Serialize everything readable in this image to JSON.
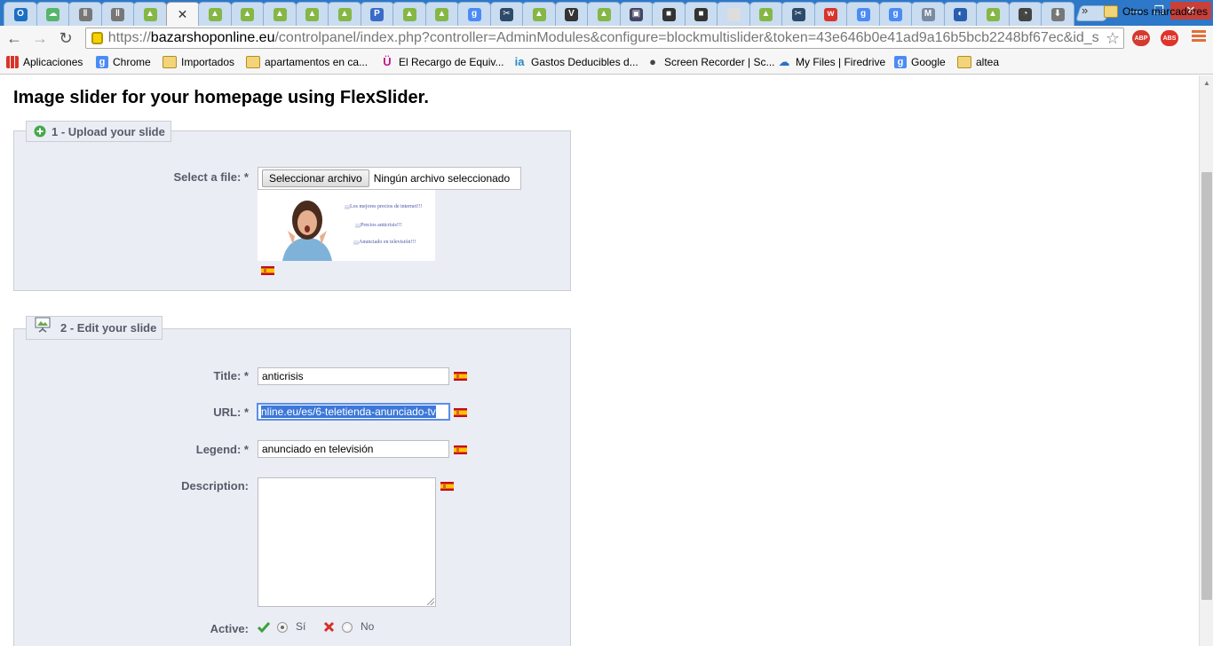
{
  "browser": {
    "tabs": [
      {
        "icon": "outlook-icon",
        "color": "#1b6fc4",
        "glyph": "O"
      },
      {
        "icon": "cloud-icon",
        "color": "#56b56c",
        "glyph": "☁"
      },
      {
        "icon": "pause-icon",
        "color": "#777777",
        "glyph": "‖"
      },
      {
        "icon": "pause-icon",
        "color": "#777777",
        "glyph": "‖"
      },
      {
        "icon": "shop-icon",
        "color": "#84b745",
        "glyph": "▲"
      },
      {
        "icon": "close-icon",
        "color": "#333333",
        "glyph": "✕"
      },
      {
        "icon": "shop-icon",
        "color": "#84b745",
        "glyph": "▲"
      },
      {
        "icon": "shop-icon",
        "color": "#84b745",
        "glyph": "▲"
      },
      {
        "icon": "shop-icon",
        "color": "#84b745",
        "glyph": "▲"
      },
      {
        "icon": "shop-icon",
        "color": "#84b745",
        "glyph": "▲"
      },
      {
        "icon": "shop-icon",
        "color": "#84b745",
        "glyph": "▲"
      },
      {
        "icon": "p-icon",
        "color": "#3b6bc9",
        "glyph": "P"
      },
      {
        "icon": "shop-icon",
        "color": "#84b745",
        "glyph": "▲"
      },
      {
        "icon": "shop-icon",
        "color": "#84b745",
        "glyph": "▲"
      },
      {
        "icon": "google-icon",
        "color": "#4c8bf5",
        "glyph": "g"
      },
      {
        "icon": "scissors-icon",
        "color": "#2d4a6a",
        "glyph": "✂"
      },
      {
        "icon": "shop-icon",
        "color": "#84b745",
        "glyph": "▲"
      },
      {
        "icon": "v-icon",
        "color": "#333333",
        "glyph": "V"
      },
      {
        "icon": "shop-icon",
        "color": "#84b745",
        "glyph": "▲"
      },
      {
        "icon": "ioi-icon",
        "color": "#444466",
        "glyph": "▣"
      },
      {
        "icon": "bag-icon",
        "color": "#333333",
        "glyph": "■"
      },
      {
        "icon": "bag-icon",
        "color": "#333333",
        "glyph": "■"
      },
      {
        "icon": "blank-icon",
        "color": "#dddddd",
        "glyph": ""
      },
      {
        "icon": "shop-icon",
        "color": "#84b745",
        "glyph": "▲"
      },
      {
        "icon": "scissors-icon",
        "color": "#2d4a6a",
        "glyph": "✂"
      },
      {
        "icon": "w-icon",
        "color": "#d9342b",
        "glyph": "w"
      },
      {
        "icon": "google-icon",
        "color": "#4c8bf5",
        "glyph": "g"
      },
      {
        "icon": "google-icon",
        "color": "#4c8bf5",
        "glyph": "g"
      },
      {
        "icon": "mf-icon",
        "color": "#7a8aa0",
        "glyph": "M"
      },
      {
        "icon": "circle-icon",
        "color": "#2a5fb0",
        "glyph": "◐"
      },
      {
        "icon": "shop-icon",
        "color": "#84b745",
        "glyph": "▲"
      },
      {
        "icon": "gauge-icon",
        "color": "#444444",
        "glyph": "◔"
      },
      {
        "icon": "download-icon",
        "color": "#777777",
        "glyph": "⬇"
      }
    ],
    "url_scheme": "https://",
    "url_host": "bazarshoponline.eu",
    "url_rest": "/controlpanel/index.php?controller=AdminModules&configure=blockmultislider&token=43e646b0e41ad9a16b5bcb2248bf67ec&id_s",
    "extensions": [
      "ABP",
      "ABS"
    ],
    "bookmarks": [
      {
        "label": "Aplicaciones",
        "icon": "apps-icon",
        "color": "#d9342b",
        "kind": "apps"
      },
      {
        "label": "Chrome",
        "icon": "google-icon",
        "color": "#4c8bf5",
        "kind": "g"
      },
      {
        "label": "Importados",
        "icon": "folder-icon",
        "color": "#f2d47a",
        "kind": "folder"
      },
      {
        "label": "apartamentos en ca...",
        "icon": "folder-icon",
        "color": "#f2d47a",
        "kind": "folder"
      },
      {
        "label": "El Recargo de Equiv...",
        "icon": "u-icon",
        "color": "#c2178f",
        "kind": "text",
        "glyph": "Ü"
      },
      {
        "label": "Gastos Deducibles d...",
        "icon": "ia-icon",
        "color": "#2a86c8",
        "kind": "text",
        "glyph": "ia"
      },
      {
        "label": "Screen Recorder | Sc...",
        "icon": "som-icon",
        "color": "#444444",
        "kind": "text",
        "glyph": "●"
      },
      {
        "label": "My Files | Firedrive",
        "icon": "cloud-icon",
        "color": "#2e6fc9",
        "kind": "text",
        "glyph": "☁"
      },
      {
        "label": "Google",
        "icon": "google-icon",
        "color": "#4c8bf5",
        "kind": "g"
      },
      {
        "label": "altea",
        "icon": "folder-icon",
        "color": "#f2d47a",
        "kind": "folder"
      }
    ],
    "bookmarks_more": "»",
    "other_bookmarks": "Otros marcadores"
  },
  "page": {
    "title": "Image slider for your homepage using FlexSlider.",
    "upload": {
      "legend": "1 - Upload your slide",
      "file_label": "Select a file: *",
      "file_button": "Seleccionar archivo",
      "file_status": "Ningún archivo seleccionado",
      "preview_lines": [
        "¡¡¡Los mejores precios de internet!!!",
        "¡¡¡Precios anticrisis!!!",
        "¡¡¡Anunciado en televisión!!!"
      ]
    },
    "edit": {
      "legend": "2 - Edit your slide",
      "title_label": "Title: *",
      "title_value": "anticrisis",
      "url_label": "URL: *",
      "url_value": "nline.eu/es/6-teletienda-anunciado-tv",
      "legend_label": "Legend: *",
      "legend_value": "anunciado en televisión",
      "description_label": "Description:",
      "active_label": "Active:",
      "active_yes": "Sí",
      "active_no": "No"
    }
  }
}
